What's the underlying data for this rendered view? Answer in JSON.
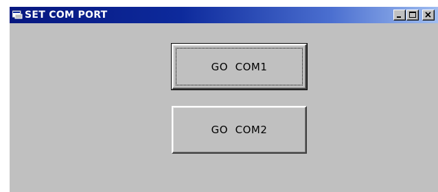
{
  "window": {
    "title": "SET COM PORT",
    "title_icon": "app-window-icon",
    "controls": {
      "minimize_icon": "minimize-icon",
      "maximize_icon": "maximize-icon",
      "close_icon": "close-icon"
    }
  },
  "buttons": [
    {
      "label": "GO  COM1",
      "focused": true
    },
    {
      "label": "GO  COM2",
      "focused": false
    }
  ],
  "colors": {
    "face": "#c0c0c0",
    "titlebar_start": "#07177f",
    "titlebar_end": "#9fbdf0",
    "title_text": "#ffffff"
  }
}
